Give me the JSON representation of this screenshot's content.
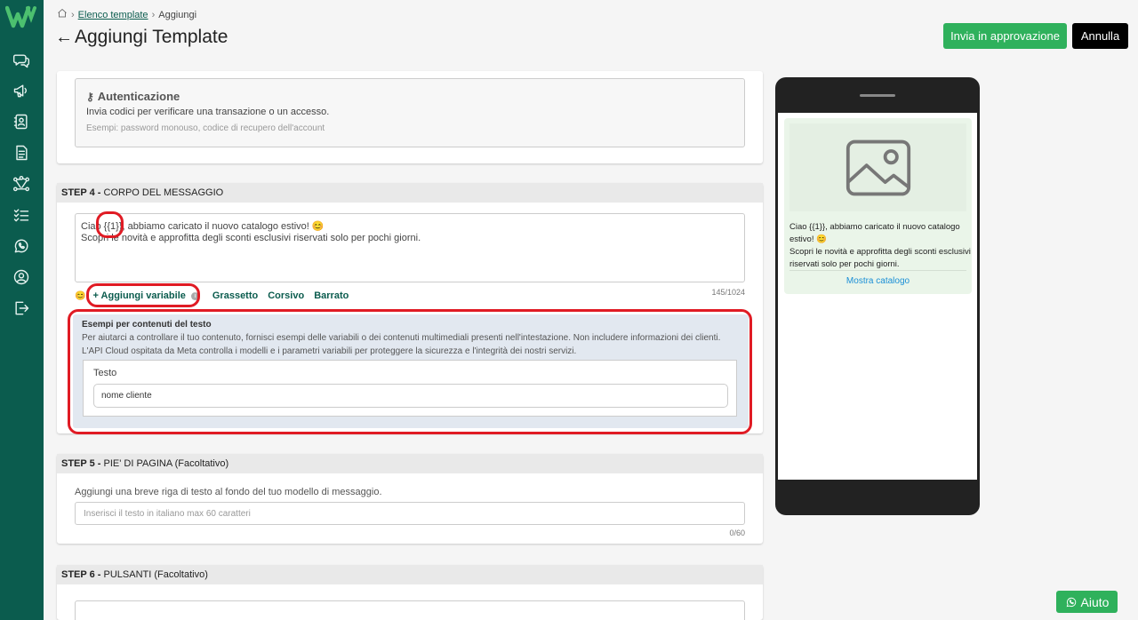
{
  "breadcrumb": {
    "home_icon": "home-icon",
    "link": "Elenco template",
    "current": "Aggiungi"
  },
  "header": {
    "title": "Aggiungi Template",
    "send_label": "Invia in approvazione",
    "cancel_label": "Annulla"
  },
  "auth": {
    "title": "Autenticazione",
    "description": "Invia codici per verificare una transazione o un accesso.",
    "examples": "Esempi: password monouso, codice di recupero dell'account"
  },
  "step4": {
    "step": "STEP 4 -",
    "title": "CORPO DEL MESSAGGIO",
    "body_line1": "Ciao {{1}}, abbiamo caricato il nuovo catalogo estivo! 😊",
    "body_line2": "Scopri le novità e approfitta degli sconti esclusivi riservati solo per pochi giorni.",
    "toolbar": {
      "emoji": "😊",
      "add_variable": "+ Aggiungi variabile",
      "bold": "Grassetto",
      "italic": "Corsivo",
      "strike": "Barrato"
    },
    "counter": "145/1024",
    "examples_title": "Esempi per contenuti del testo",
    "examples_desc1": "Per aiutarci a controllare il tuo contenuto, fornisci esempi delle variabili o dei contenuti multimediali presenti nell'intestazione. Non includere informazioni dei clienti.",
    "examples_desc2": "L'API Cloud ospitata da Meta controlla i modelli e i parametri variabili per proteggere la sicurezza e l'integrità dei nostri servizi.",
    "field_label": "Testo",
    "field_value": "nome cliente"
  },
  "step5": {
    "step": "STEP 5 -",
    "title": "PIE' DI PAGINA (Facoltativo)",
    "description": "Aggiungi una breve riga di testo al fondo del tuo modello di messaggio.",
    "placeholder": "Inserisci il testo in italiano max 60 caratteri",
    "counter": "0/60"
  },
  "step6": {
    "step": "STEP 6 -",
    "title": "PULSANTI (Facoltativo)"
  },
  "preview": {
    "line1": "Ciao {{1}}, abbiamo caricato il nuovo catalogo estivo! 😊",
    "line2": "Scopri le novità e approfitta degli sconti esclusivi riservati solo per pochi giorni.",
    "button": "Mostra catalogo"
  },
  "help": {
    "label": "Aiuto",
    "icon": "whatsapp-icon"
  },
  "colors": {
    "sidebar": "#0b5c4e",
    "primary_green": "#2fb15c",
    "highlight_red": "#e01b24"
  }
}
